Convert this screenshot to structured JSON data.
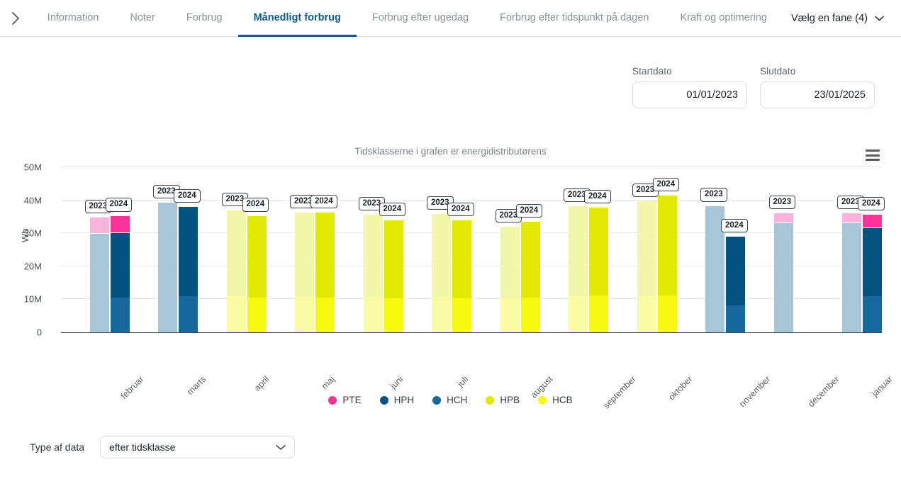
{
  "tabs": {
    "expand_icon": "chevron-right-icon",
    "items": [
      {
        "label": "Information",
        "active": false
      },
      {
        "label": "Noter",
        "active": false
      },
      {
        "label": "Forbrug",
        "active": false
      },
      {
        "label": "Månedligt forbrug",
        "active": true
      },
      {
        "label": "Forbrug efter ugedag",
        "active": false
      },
      {
        "label": "Forbrug efter tidspunkt på dagen",
        "active": false
      },
      {
        "label": "Kraft og optimering",
        "active": false
      }
    ],
    "more_label": "Vælg en fane (4)",
    "more_icon": "chevron-down-icon"
  },
  "filters": {
    "start": {
      "label": "Startdato",
      "value": "01/01/2023"
    },
    "end": {
      "label": "Slutdato",
      "value": "23/01/2025"
    }
  },
  "chart_menu_icon": "hamburger-menu-icon",
  "footer": {
    "label": "Type af data",
    "select_value": "efter tidsklasse",
    "select_icon": "chevron-down-icon"
  },
  "colors": {
    "PTE_2024": "#fb3399",
    "PTE_2023": "#fbb3dd",
    "HPH_2024": "#04527f",
    "HPH_2023": "#a9c6d8",
    "HCH_2024": "#17689c",
    "HCH_2023": "#a9c6d8",
    "HPB_2024": "#e3e800",
    "HPB_2023": "#f2f6a8",
    "HCB_2024": "#f7f90f",
    "HCB_2023": "#fafca3",
    "accent": "#0d5c8c",
    "axis": "#3d4450",
    "grid": "#e6e8ea"
  },
  "chart_data": {
    "type": "bar",
    "subtype": "grouped-stacked",
    "title": "Tidsklasserne i grafen er energidistributørens",
    "xlabel": "",
    "ylabel": "Wh",
    "ylim": [
      0,
      50000000
    ],
    "ytick_labels": [
      "0",
      "10M",
      "20M",
      "30M",
      "40M",
      "50M"
    ],
    "ytick_values": [
      0,
      10000000,
      20000000,
      30000000,
      40000000,
      50000000
    ],
    "grid": true,
    "legend_position": "bottom",
    "legend": [
      "PTE",
      "HPH",
      "HCH",
      "HPB",
      "HCB"
    ],
    "group_labels": [
      "2023",
      "2024"
    ],
    "categories": [
      "februar",
      "marts",
      "april",
      "maj",
      "juni",
      "juli",
      "august",
      "september",
      "oktober",
      "november",
      "december",
      "januar"
    ],
    "groups": [
      {
        "category": "februar",
        "bars": [
          {
            "year": "2023",
            "total": 34800000,
            "segments": [
              {
                "series": "HCH",
                "value": 10500000
              },
              {
                "series": "HPH",
                "value": 19300000
              },
              {
                "series": "PTE",
                "value": 5000000
              }
            ]
          },
          {
            "year": "2024",
            "total": 35300000,
            "segments": [
              {
                "series": "HCH",
                "value": 10500000
              },
              {
                "series": "HPH",
                "value": 19500000
              },
              {
                "series": "PTE",
                "value": 5300000
              }
            ]
          }
        ]
      },
      {
        "category": "marts",
        "bars": [
          {
            "year": "2023",
            "total": 39200000,
            "segments": [
              {
                "series": "HCH",
                "value": 11400000
              },
              {
                "series": "HPH",
                "value": 27800000
              }
            ]
          },
          {
            "year": "2024",
            "total": 38000000,
            "segments": [
              {
                "series": "HCH",
                "value": 11000000
              },
              {
                "series": "HPH",
                "value": 27000000
              }
            ]
          }
        ]
      },
      {
        "category": "april",
        "bars": [
          {
            "year": "2023",
            "total": 37000000,
            "segments": [
              {
                "series": "HCB",
                "value": 11000000
              },
              {
                "series": "HPB",
                "value": 26000000
              }
            ]
          },
          {
            "year": "2024",
            "total": 35300000,
            "segments": [
              {
                "series": "HCB",
                "value": 10600000
              },
              {
                "series": "HPB",
                "value": 24700000
              }
            ]
          }
        ]
      },
      {
        "category": "maj",
        "bars": [
          {
            "year": "2023",
            "total": 36200000,
            "segments": [
              {
                "series": "HCB",
                "value": 10700000
              },
              {
                "series": "HPB",
                "value": 25500000
              }
            ]
          },
          {
            "year": "2024",
            "total": 36200000,
            "segments": [
              {
                "series": "HCB",
                "value": 10600000
              },
              {
                "series": "HPB",
                "value": 25600000
              }
            ]
          }
        ]
      },
      {
        "category": "juni",
        "bars": [
          {
            "year": "2023",
            "total": 35700000,
            "segments": [
              {
                "series": "HCB",
                "value": 10700000
              },
              {
                "series": "HPB",
                "value": 25000000
              }
            ]
          },
          {
            "year": "2024",
            "total": 34000000,
            "segments": [
              {
                "series": "HCB",
                "value": 10400000
              },
              {
                "series": "HPB",
                "value": 23600000
              }
            ]
          }
        ]
      },
      {
        "category": "juli",
        "bars": [
          {
            "year": "2023",
            "total": 35900000,
            "segments": [
              {
                "series": "HCB",
                "value": 10700000
              },
              {
                "series": "HPB",
                "value": 25200000
              }
            ]
          },
          {
            "year": "2024",
            "total": 34000000,
            "segments": [
              {
                "series": "HCB",
                "value": 10400000
              },
              {
                "series": "HPB",
                "value": 23600000
              }
            ]
          }
        ]
      },
      {
        "category": "august",
        "bars": [
          {
            "year": "2023",
            "total": 32000000,
            "segments": [
              {
                "series": "HCB",
                "value": 10400000
              },
              {
                "series": "HPB",
                "value": 21600000
              }
            ]
          },
          {
            "year": "2024",
            "total": 33500000,
            "segments": [
              {
                "series": "HCB",
                "value": 10500000
              },
              {
                "series": "HPB",
                "value": 23000000
              }
            ]
          }
        ]
      },
      {
        "category": "september",
        "bars": [
          {
            "year": "2023",
            "total": 38200000,
            "segments": [
              {
                "series": "HCB",
                "value": 11000000
              },
              {
                "series": "HPB",
                "value": 27200000
              }
            ]
          },
          {
            "year": "2024",
            "total": 37800000,
            "segments": [
              {
                "series": "HCB",
                "value": 11200000
              },
              {
                "series": "HPB",
                "value": 26600000
              }
            ]
          }
        ]
      },
      {
        "category": "oktober",
        "bars": [
          {
            "year": "2023",
            "total": 39700000,
            "segments": [
              {
                "series": "HCB",
                "value": 11000000
              },
              {
                "series": "HPB",
                "value": 28700000
              }
            ]
          },
          {
            "year": "2024",
            "total": 41500000,
            "segments": [
              {
                "series": "HCB",
                "value": 11200000
              },
              {
                "series": "HPB",
                "value": 30300000
              }
            ]
          }
        ]
      },
      {
        "category": "november",
        "bars": [
          {
            "year": "2023",
            "total": 38300000,
            "segments": [
              {
                "series": "HCH",
                "value": 11000000
              },
              {
                "series": "HPH",
                "value": 27300000
              }
            ]
          },
          {
            "year": "2024",
            "total": 28900000,
            "segments": [
              {
                "series": "HCH",
                "value": 8200000
              },
              {
                "series": "HPH",
                "value": 20700000
              }
            ]
          }
        ]
      },
      {
        "category": "december",
        "bars": [
          {
            "year": "2023",
            "total": 36000000,
            "segments": [
              {
                "series": "HCH",
                "value": 10600000
              },
              {
                "series": "HPH",
                "value": 22400000
              },
              {
                "series": "PTE",
                "value": 3000000
              }
            ]
          }
        ]
      },
      {
        "category": "januar",
        "bars": [
          {
            "year": "2023",
            "total": 36000000,
            "segments": [
              {
                "series": "HCH",
                "value": 10700000
              },
              {
                "series": "HPH",
                "value": 22300000
              },
              {
                "series": "PTE",
                "value": 3000000
              }
            ]
          },
          {
            "year": "2024",
            "total": 35700000,
            "segments": [
              {
                "series": "HCH",
                "value": 11000000
              },
              {
                "series": "HPH",
                "value": 20500000
              },
              {
                "series": "PTE",
                "value": 4200000
              }
            ]
          }
        ]
      }
    ]
  }
}
